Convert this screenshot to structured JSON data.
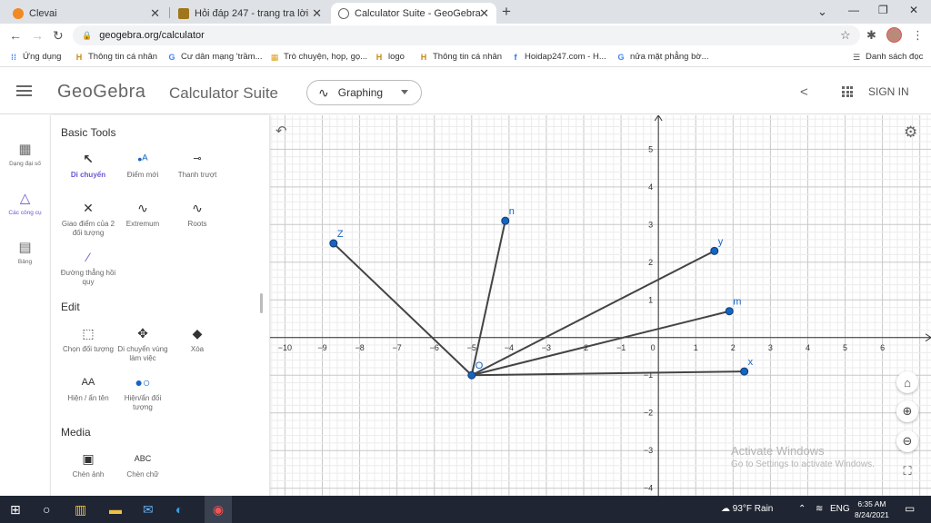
{
  "browser": {
    "tabs": [
      {
        "title": "Clevai",
        "icon_color": "#f08a24"
      },
      {
        "title": "Hỏi đáp 247 - trang tra lời",
        "icon_color": "#a0761d"
      },
      {
        "title": "Calculator Suite - GeoGebra",
        "icon_color": "#666666"
      }
    ],
    "url": "geogebra.org/calculator",
    "bookmarks": [
      {
        "label": "Ứng dụng",
        "icon": "apps-grid"
      },
      {
        "label": "Thông tin cá nhân",
        "icon": "h-bookmark"
      },
      {
        "label": "Cư dân mạng 'trầm...",
        "icon": "google-g"
      },
      {
        "label": "Trò chuyện, họp, gọ...",
        "icon": "teams"
      },
      {
        "label": "logo",
        "icon": "h-bookmark"
      },
      {
        "label": "Thông tin cá nhân",
        "icon": "h-bookmark"
      },
      {
        "label": "Hoidap247.com - H...",
        "icon": "facebook"
      },
      {
        "label": "nửa mặt phẳng bờ...",
        "icon": "google-g"
      }
    ],
    "reading_list": "Danh sách đọc"
  },
  "header": {
    "logo": "GeoGebra",
    "suite": "Calculator Suite",
    "app": "Graphing",
    "signin": "SIGN IN"
  },
  "rail": [
    {
      "label": "Dạng đại số",
      "icon": "calculator-icon"
    },
    {
      "label": "Các công cụ",
      "icon": "tools-icon"
    },
    {
      "label": "Bảng",
      "icon": "table-icon"
    }
  ],
  "tools": {
    "basic_title": "Basic Tools",
    "basic": [
      "Di chuyển",
      "Điểm mới",
      "Thanh trượt",
      "Giao điểm của 2 đối tượng",
      "Extremum",
      "Roots",
      "Đường thẳng hồi quy"
    ],
    "edit_title": "Edit",
    "edit": [
      "Chọn đối tượng",
      "Di chuyển vùng làm việc",
      "Xóa",
      "Hiện / ẩn tên",
      "Hiện/ẩn đối tượng"
    ],
    "media_title": "Media",
    "media": [
      "Chèn ảnh",
      "Chèn chữ"
    ]
  },
  "chart_data": {
    "type": "scatter",
    "xlim": [
      -10.4,
      7.3
    ],
    "ylim": [
      -4.2,
      5.9
    ],
    "x_ticks": [
      -10,
      -9,
      -8,
      -7,
      -6,
      -5,
      -4,
      -3,
      -2,
      -1,
      0,
      1,
      2,
      3,
      4,
      5,
      6
    ],
    "y_ticks": [
      -4,
      -3,
      -2,
      -1,
      1,
      2,
      3,
      4,
      5
    ],
    "origin_label": "0",
    "grid": true,
    "points": [
      {
        "name": "O",
        "x": -5.0,
        "y": -1.0
      },
      {
        "name": "Z",
        "x": -8.7,
        "y": 2.5
      },
      {
        "name": "n",
        "x": -4.1,
        "y": 3.1
      },
      {
        "name": "y",
        "x": 1.5,
        "y": 2.3
      },
      {
        "name": "m",
        "x": 1.9,
        "y": 0.7
      },
      {
        "name": "x",
        "x": 2.3,
        "y": -0.9
      }
    ],
    "segments": [
      [
        "O",
        "Z"
      ],
      [
        "O",
        "n"
      ],
      [
        "O",
        "y"
      ],
      [
        "O",
        "m"
      ],
      [
        "O",
        "x"
      ]
    ],
    "point_color": "#1565c0",
    "segment_color": "#444444"
  },
  "watermark": {
    "line1": "Activate Windows",
    "line2": "Go to Settings to activate Windows."
  },
  "taskbar": {
    "weather": "93°F  Rain",
    "lang": "ENG",
    "time": "6:35 AM",
    "date": "8/24/2021"
  }
}
